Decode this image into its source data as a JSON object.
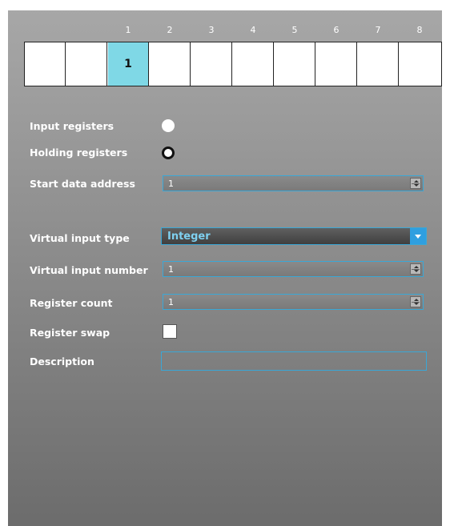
{
  "register_map": {
    "indices": [
      "1",
      "2",
      "3",
      "4",
      "5",
      "6",
      "7",
      "8"
    ],
    "cells": [
      "",
      "",
      "1",
      "",
      "",
      "",
      "",
      "",
      "",
      ""
    ],
    "active_cell": 2
  },
  "form": {
    "input_registers_label": "Input registers",
    "holding_registers_label": "Holding registers",
    "start_data_address_label": "Start data address",
    "start_data_address_value": "1",
    "virtual_input_type_label": "Virtual input type",
    "virtual_input_type_value": "Integer",
    "virtual_input_number_label": "Virtual input number",
    "virtual_input_number_value": "1",
    "register_count_label": "Register count",
    "register_count_value": "1",
    "register_swap_label": "Register swap",
    "description_label": "Description",
    "description_value": ""
  },
  "state": {
    "selected_register_type": "holding",
    "register_swap_checked": false
  },
  "colors": {
    "accent": "#3aa7d6",
    "active_cell": "#7fd8e6",
    "dropdown_button": "#2f9fe0"
  },
  "icons": {
    "spinner": "spin-up-down-icon",
    "dropdown": "chevron-down-icon"
  }
}
